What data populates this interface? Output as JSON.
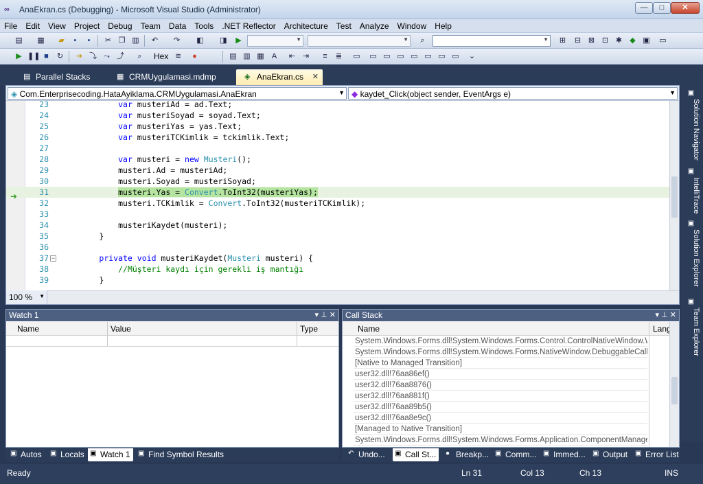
{
  "window": {
    "title": "AnaEkran.cs (Debugging) - Microsoft Visual Studio (Administrator)",
    "app_icon": "vs-infinity-icon",
    "controls": {
      "minimize": "—",
      "maximize": "□",
      "close": "✕"
    }
  },
  "menu": [
    "File",
    "Edit",
    "View",
    "Project",
    "Debug",
    "Team",
    "Data",
    "Tools",
    ".NET Reflector",
    "Architecture",
    "Test",
    "Analyze",
    "Window",
    "Help"
  ],
  "toolbar2": {
    "hex_label": "Hex"
  },
  "doc_tabs": [
    {
      "label": "Parallel Stacks",
      "icon": "parallel-stacks-icon",
      "active": false
    },
    {
      "label": "CRMUygulamasi.mdmp",
      "icon": "dump-file-icon",
      "active": false
    },
    {
      "label": "AnaEkran.cs",
      "icon": "csharp-file-icon",
      "active": true
    }
  ],
  "editor": {
    "class_combo": "Com.Enterprisecoding.HataAyiklama.CRMUygulamasi.AnaEkran",
    "member_combo": "kaydet_Click(object sender, EventArgs e)",
    "zoom": "100 %",
    "lines": [
      {
        "n": "23",
        "code": "            var musteriAd = ad.Text;"
      },
      {
        "n": "24",
        "code": "            var musteriSoyad = soyad.Text;"
      },
      {
        "n": "25",
        "code": "            var musteriYas = yas.Text;"
      },
      {
        "n": "26",
        "code": "            var musteriTCKimlik = tckimlik.Text;"
      },
      {
        "n": "27",
        "code": ""
      },
      {
        "n": "28",
        "code": "            var musteri = new Musteri();"
      },
      {
        "n": "29",
        "code": "            musteri.Ad = musteriAd;"
      },
      {
        "n": "30",
        "code": "            musteri.Soyad = musteriSoyad;"
      },
      {
        "n": "31",
        "code": "            musteri.Yas = Convert.ToInt32(musteriYas);"
      },
      {
        "n": "32",
        "code": "            musteri.TCKimlik = Convert.ToInt32(musteriTCKimlik);"
      },
      {
        "n": "33",
        "code": ""
      },
      {
        "n": "34",
        "code": "            musteriKaydet(musteri);"
      },
      {
        "n": "35",
        "code": "        }"
      },
      {
        "n": "36",
        "code": ""
      },
      {
        "n": "37",
        "code": "        private void musteriKaydet(Musteri musteri) {"
      },
      {
        "n": "38",
        "code": "            //Müşteri kaydı için gerekli iş mantığı"
      },
      {
        "n": "39",
        "code": "        }"
      }
    ]
  },
  "side_tabs": [
    {
      "label": "Solution Navigator",
      "icon": "solution-navigator-icon"
    },
    {
      "label": "IntelliTrace",
      "icon": "intellitrace-icon"
    },
    {
      "label": "Solution Explorer",
      "icon": "solution-explorer-icon"
    },
    {
      "label": "Team Explorer",
      "icon": "team-explorer-icon"
    }
  ],
  "watch": {
    "title": "Watch 1",
    "columns": [
      "Name",
      "Value",
      "Type"
    ]
  },
  "callstack": {
    "title": "Call Stack",
    "columns": [
      "Name",
      "Lang"
    ],
    "rows": [
      "System.Windows.Forms.dll!System.Windows.Forms.Control.ControlNativeWindow.Wnd",
      "System.Windows.Forms.dll!System.Windows.Forms.NativeWindow.DebuggableCallbac",
      "[Native to Managed Transition]",
      "user32.dll!76aa86ef()",
      "user32.dll!76aa8876()",
      "user32.dll!76aa881f()",
      "user32.dll!76aa89b5()",
      "user32.dll!76aa8e9c()",
      "[Managed to Native Transition]",
      "System.Windows.Forms.dll!System.Windows.Forms.Application.ComponentManager.S"
    ]
  },
  "bottom_tabs_left": [
    {
      "label": "Autos",
      "icon": "autos-icon",
      "active": false
    },
    {
      "label": "Locals",
      "icon": "locals-icon",
      "active": false
    },
    {
      "label": "Watch 1",
      "icon": "watch-icon",
      "active": true
    },
    {
      "label": "Find Symbol Results",
      "icon": "find-symbol-icon",
      "active": false
    }
  ],
  "bottom_tabs_right": [
    {
      "label": "Undo...",
      "icon": "undo-icon",
      "active": false
    },
    {
      "label": "Call St...",
      "icon": "call-stack-icon",
      "active": true
    },
    {
      "label": "Breakp...",
      "icon": "breakpoints-icon",
      "active": false
    },
    {
      "label": "Comm...",
      "icon": "command-window-icon",
      "active": false
    },
    {
      "label": "Immed...",
      "icon": "immediate-window-icon",
      "active": false
    },
    {
      "label": "Output",
      "icon": "output-icon",
      "active": false
    },
    {
      "label": "Error List",
      "icon": "error-list-icon",
      "active": false
    }
  ],
  "status": {
    "state": "Ready",
    "line": "Ln 31",
    "col": "Col 13",
    "ch": "Ch 13",
    "mode": "INS"
  }
}
